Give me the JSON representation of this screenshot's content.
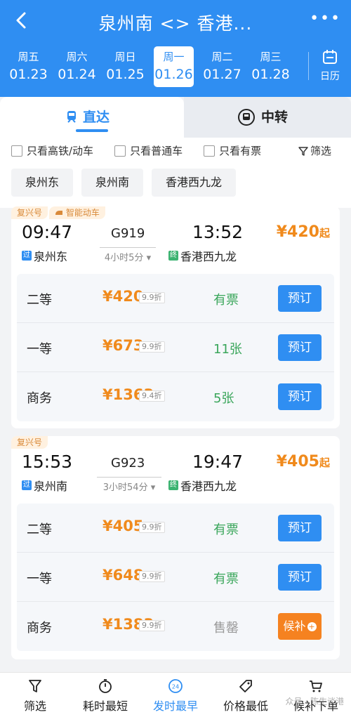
{
  "header": {
    "title": "泉州南 <> 香港...",
    "more": "•••",
    "calendar_label": "日历"
  },
  "dates": [
    {
      "weekday": "周五",
      "date": "01.23"
    },
    {
      "weekday": "周六",
      "date": "01.24"
    },
    {
      "weekday": "周日",
      "date": "01.25"
    },
    {
      "weekday": "周一",
      "date": "01.26",
      "active": true
    },
    {
      "weekday": "周二",
      "date": "01.27"
    },
    {
      "weekday": "周三",
      "date": "01.28"
    }
  ],
  "tabs": {
    "direct": "直达",
    "transfer": "中转"
  },
  "filters": {
    "high_speed": "只看高铁/动车",
    "normal": "只看普通车",
    "available": "只看有票",
    "screen": "筛选"
  },
  "stations": [
    "泉州东",
    "泉州南",
    "香港西九龙"
  ],
  "trains": [
    {
      "tags": [
        "复兴号",
        "智能动车"
      ],
      "dep_time": "09:47",
      "arr_time": "13:52",
      "train_no": "G919",
      "duration": "4小时5分",
      "from_mark": "过",
      "from": "泉州东",
      "to_mark": "终",
      "to": "香港西九龙",
      "min_price": "¥420",
      "min_suffix": "起",
      "seats": [
        {
          "name": "二等",
          "price": "¥420",
          "discount": "9.9折",
          "avail": "有票",
          "action": "预订"
        },
        {
          "name": "一等",
          "price": "¥673",
          "discount": "9.9折",
          "avail": "11张",
          "action": "预订"
        },
        {
          "name": "商务",
          "price": "¥1363",
          "discount": "9.4折",
          "avail": "5张",
          "action": "预订"
        }
      ]
    },
    {
      "tags": [
        "复兴号"
      ],
      "dep_time": "15:53",
      "arr_time": "19:47",
      "train_no": "G923",
      "duration": "3小时54分",
      "from_mark": "过",
      "from": "泉州南",
      "to_mark": "终",
      "to": "香港西九龙",
      "min_price": "¥405",
      "min_suffix": "起",
      "seats": [
        {
          "name": "二等",
          "price": "¥405",
          "discount": "9.9折",
          "avail": "有票",
          "action": "预订"
        },
        {
          "name": "一等",
          "price": "¥648",
          "discount": "9.9折",
          "avail": "有票",
          "action": "预订"
        },
        {
          "name": "商务",
          "price": "¥1383",
          "discount": "9.9折",
          "avail": "售罄",
          "action": "候补"
        }
      ]
    }
  ],
  "colors": {
    "primary": "#2f8ef2",
    "price": "#f08a1c",
    "available": "#3aa65b",
    "soldout": "#999999",
    "waitlist": "#f58220"
  },
  "bottom_nav": [
    {
      "label": "筛选",
      "icon": "filter-icon"
    },
    {
      "label": "耗时最短",
      "icon": "stopwatch-icon"
    },
    {
      "label": "发时最早",
      "icon": "clock-24-icon",
      "active": true
    },
    {
      "label": "价格最低",
      "icon": "price-tag-icon"
    },
    {
      "label": "候补下单",
      "icon": "cart-icon"
    }
  ],
  "watermark": "众号 · 陈生谈港"
}
